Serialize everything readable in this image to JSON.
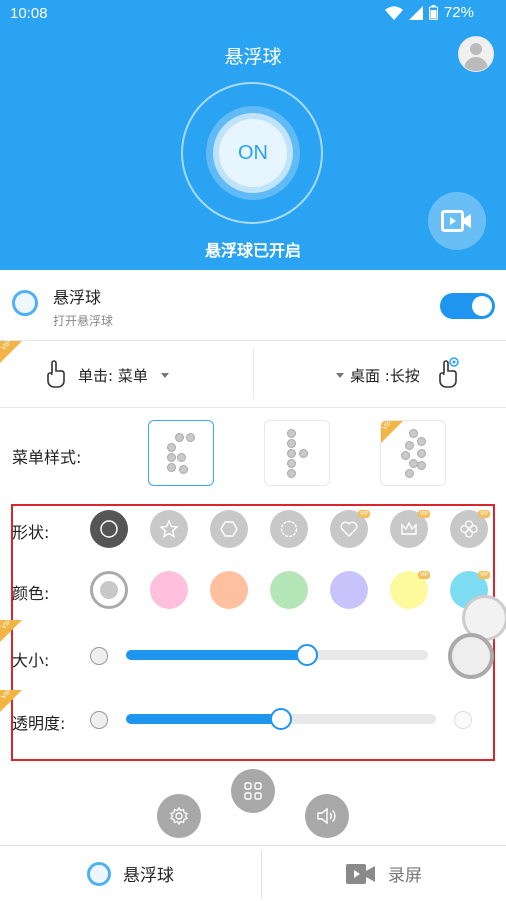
{
  "status_bar": {
    "time": "10:08",
    "battery": "72%"
  },
  "header": {
    "title": "悬浮球",
    "on_label": "ON",
    "status": "悬浮球已开启"
  },
  "toggle": {
    "title": "悬浮球",
    "subtitle": "打开悬浮球",
    "enabled": true
  },
  "click_actions": {
    "vip_badge": "VIP",
    "single_click": "单击: 菜单",
    "long_press": "桌面 :长按"
  },
  "menu_style": {
    "label": "菜单样式:",
    "vip_badge": "VIP"
  },
  "options": {
    "shape_label": "形状:",
    "color_label": "颜色:",
    "size_label": "大小:",
    "opacity_label": "透明度:",
    "vip_badge": "VIP",
    "size_value": 0.6,
    "opacity_value": 0.5,
    "colors": [
      "#ffc0de",
      "#ffc0a0",
      "#b4e6b8",
      "#c9c3fb",
      "#fdfa9e",
      "#7ddcf2"
    ]
  },
  "tabs": [
    {
      "label": "悬浮球",
      "active": true
    },
    {
      "label": "录屏",
      "active": false
    }
  ],
  "colors": {
    "primary": "#2aa3f2",
    "switch": "#1e96ef",
    "highlight_border": "#d9262c",
    "vip": "#f2b544"
  }
}
